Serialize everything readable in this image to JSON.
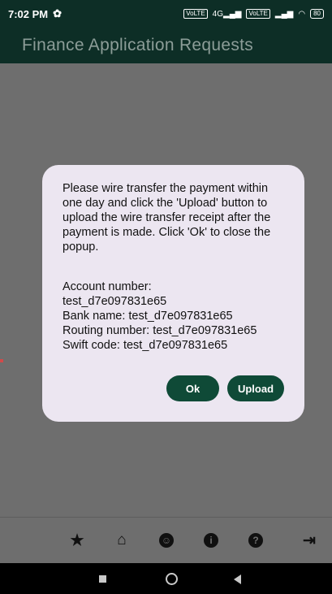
{
  "status_bar": {
    "time": "7:02 PM",
    "sim1": "VoLTE",
    "net": "4G",
    "sim2": "VoLTE",
    "battery": "80"
  },
  "app_bar": {
    "title": "Finance Application Requests"
  },
  "dialog": {
    "message": "Please wire transfer the payment within one day and click the 'Upload' button to upload the wire transfer receipt after the payment is made. Click 'Ok' to close the popup.",
    "account_number": "Account number: test_d7e097831e65",
    "bank_name": "Bank name: test_d7e097831e65",
    "routing_number": "Routing number: test_d7e097831e65",
    "swift_code": "Swift code: test_d7e097831e65",
    "ok_label": "Ok",
    "upload_label": "Upload"
  },
  "bottom_nav": {
    "items": [
      {
        "icon": "star-icon"
      },
      {
        "icon": "home-icon"
      },
      {
        "icon": "account-icon"
      },
      {
        "icon": "info-icon"
      },
      {
        "icon": "help-icon"
      },
      {
        "icon": "logout-icon"
      }
    ]
  }
}
